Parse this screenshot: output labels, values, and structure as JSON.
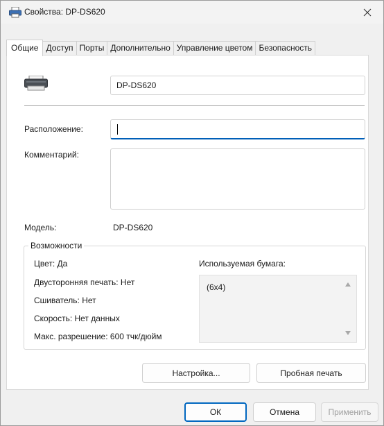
{
  "window": {
    "title": "Свойства: DP-DS620"
  },
  "tabs": [
    {
      "label": "Общие",
      "active": true
    },
    {
      "label": "Доступ"
    },
    {
      "label": "Порты"
    },
    {
      "label": "Дополнительно"
    },
    {
      "label": "Управление цветом"
    },
    {
      "label": "Безопасность"
    }
  ],
  "general": {
    "printer_name": "DP-DS620",
    "location_label": "Расположение:",
    "location_value": "",
    "comment_label": "Комментарий:",
    "comment_value": "",
    "model_label": "Модель:",
    "model_value": "DP-DS620"
  },
  "features": {
    "legend": "Возможности",
    "color": "Цвет: Да",
    "duplex": "Двусторонняя печать: Нет",
    "stapler": "Сшиватель: Нет",
    "speed": "Скорость: Нет данных",
    "max_resolution": "Макс. разрешение: 600 тчк/дюйм",
    "paper_label": "Используемая бумага:",
    "paper_items": [
      "(6x4)"
    ]
  },
  "buttons": {
    "preferences": "Настройка...",
    "test_page": "Пробная печать",
    "ok": "ОК",
    "cancel": "Отмена",
    "apply": "Применить"
  },
  "colors": {
    "accent": "#005fb8"
  }
}
